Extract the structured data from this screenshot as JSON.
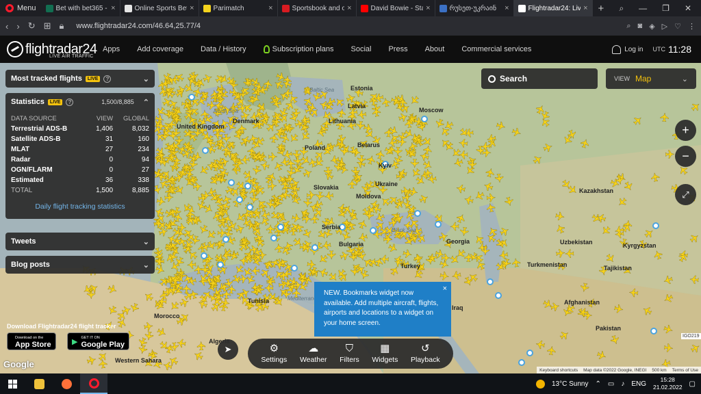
{
  "browser": {
    "menu_label": "Menu",
    "tabs": [
      {
        "title": "Bet with bet365 - I",
        "color": "#126e51"
      },
      {
        "title": "Online Sports Betti",
        "color": "#e5e5e5"
      },
      {
        "title": "Parimatch",
        "color": "#f4d31d"
      },
      {
        "title": "Sportsbook and o",
        "color": "#d81b21"
      },
      {
        "title": "David Bowie - Star",
        "color": "#ff0000"
      },
      {
        "title": "რუსეთ-უკრაინ",
        "color": "#3b70c4"
      },
      {
        "title": "Flightradar24: Live",
        "color": "#ffffff"
      }
    ],
    "url": "www.flightradar24.com/46.64,25.77/4"
  },
  "header": {
    "logo_text": "flightradar24",
    "logo_sub": "LIVE AIR TRAFFIC",
    "menu": [
      {
        "label": "Apps"
      },
      {
        "label": "Add coverage"
      },
      {
        "label": "Data / History"
      },
      {
        "label": "Subscription plans"
      },
      {
        "label": "Social"
      },
      {
        "label": "Press"
      },
      {
        "label": "About"
      },
      {
        "label": "Commercial services"
      }
    ],
    "login_label": "Log in",
    "utc_label": "UTC",
    "time": "11:28"
  },
  "panels": {
    "most_tracked": "Most tracked flights",
    "live_badge": "LIVE",
    "statistics": "Statistics",
    "stat_count": "1,500/8,885",
    "stats_head": {
      "source": "DATA SOURCE",
      "view": "VIEW",
      "global": "GLOBAL"
    },
    "stats_rows": [
      {
        "label": "Terrestrial ADS-B",
        "view": "1,406",
        "global": "8,032"
      },
      {
        "label": "Satellite ADS-B",
        "view": "31",
        "global": "160"
      },
      {
        "label": "MLAT",
        "view": "27",
        "global": "234"
      },
      {
        "label": "Radar",
        "view": "0",
        "global": "94"
      },
      {
        "label": "OGN/FLARM",
        "view": "0",
        "global": "27"
      },
      {
        "label": "Estimated",
        "view": "36",
        "global": "338"
      },
      {
        "label": "TOTAL",
        "view": "1,500",
        "global": "8,885"
      }
    ],
    "daily_link": "Daily flight tracking statistics",
    "tweets": "Tweets",
    "blog": "Blog posts"
  },
  "map": {
    "search_label": "Search",
    "view_label": "VIEW",
    "view_value": "Map",
    "zoom_in": "+",
    "zoom_out": "−",
    "notice": "NEW. Bookmarks widget now available. Add multiple aircraft, flights, airports and locations to a widget on your home screen.",
    "notice_close": "×",
    "toolbar": [
      {
        "label": "Settings",
        "icon": "settings-icon"
      },
      {
        "label": "Weather",
        "icon": "weather-icon"
      },
      {
        "label": "Filters",
        "icon": "filter-icon"
      },
      {
        "label": "Widgets",
        "icon": "widgets-icon"
      },
      {
        "label": "Playback",
        "icon": "playback-icon"
      }
    ],
    "download_text": "Download Flightradar24 flight tracker",
    "appstore_small": "Download on the",
    "appstore_big": "App Store",
    "gplay_small": "GET IT ON",
    "gplay_big": "Google Play",
    "google": "Google",
    "attr": [
      "Keyboard shortcuts",
      "Map data ©2022 Google, INEGI",
      "500 km",
      "Terms of Use"
    ],
    "igo": "IGO219",
    "labels": [
      {
        "text": "United Kingdom",
        "kind": "country"
      },
      {
        "text": "Latvia",
        "kind": "country"
      },
      {
        "text": "Lithuania",
        "kind": "country"
      },
      {
        "text": "Belarus",
        "kind": "country"
      },
      {
        "text": "Poland",
        "kind": "country"
      },
      {
        "text": "Ukraine",
        "kind": "country"
      },
      {
        "text": "Moldova",
        "kind": "country"
      },
      {
        "text": "Slovakia",
        "kind": "country"
      },
      {
        "text": "Kazakhstan",
        "kind": "country"
      },
      {
        "text": "Uzbekistan",
        "kind": "country"
      },
      {
        "text": "Kyrgyzstan",
        "kind": "country"
      },
      {
        "text": "Turkmenistan",
        "kind": "country"
      },
      {
        "text": "Tajikistan",
        "kind": "country"
      },
      {
        "text": "Afghanistan",
        "kind": "country"
      },
      {
        "text": "Pakistan",
        "kind": "country"
      },
      {
        "text": "Georgia",
        "kind": "country"
      },
      {
        "text": "Tunisia",
        "kind": "country"
      },
      {
        "text": "Morocco",
        "kind": "country"
      },
      {
        "text": "Western Sahara",
        "kind": "country"
      },
      {
        "text": "Turkey",
        "kind": "country"
      },
      {
        "text": "Iraq",
        "kind": "country"
      },
      {
        "text": "Bulgaria",
        "kind": "country"
      },
      {
        "text": "Serbia",
        "kind": "country"
      },
      {
        "text": "Kyiv",
        "kind": "country"
      },
      {
        "text": "Moscow",
        "kind": "country"
      },
      {
        "text": "Estonia",
        "kind": "country"
      },
      {
        "text": "Denmark",
        "kind": "country"
      },
      {
        "text": "Algeria",
        "kind": "country"
      },
      {
        "text": "Baltic Sea",
        "kind": "sea"
      },
      {
        "text": "Black Sea",
        "kind": "sea"
      },
      {
        "text": "North Sea",
        "kind": "sea"
      },
      {
        "text": "Mediterranean",
        "kind": "sea"
      }
    ]
  },
  "taskbar": {
    "weather": "13°C  Sunny",
    "lang": "ENG",
    "time": "15:28",
    "date": "21.02.2022"
  },
  "colors": {
    "accent": "#f4c20d",
    "plane": "#f6d21a",
    "link": "#74b6ea",
    "notice": "#1f7fc7"
  }
}
